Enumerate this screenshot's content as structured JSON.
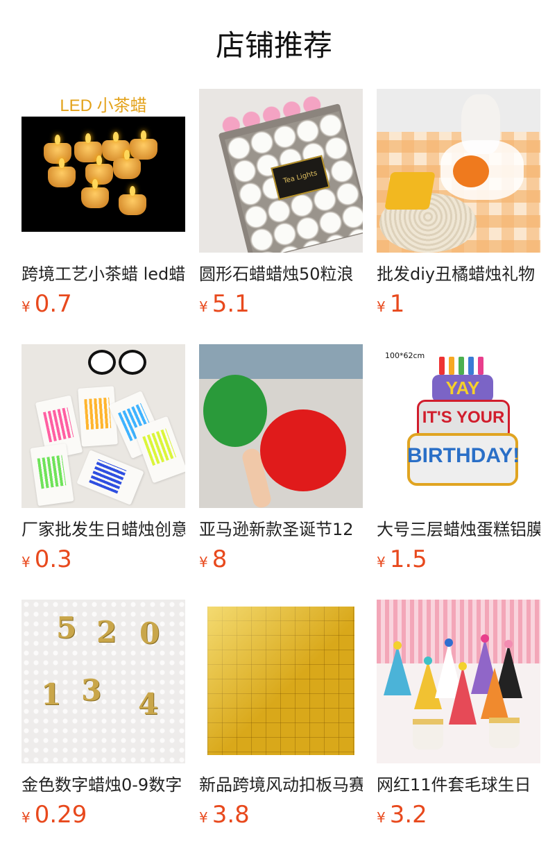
{
  "header": {
    "title": "店铺推荐"
  },
  "currency": "¥",
  "products": [
    {
      "name": "跨境工艺小茶蜡 led蜡",
      "price": "0.7",
      "image_text": "LED 小茶蜡"
    },
    {
      "name": "圆形石蜡蜡烛50粒浪",
      "price": "5.1",
      "image_text": "Tea Lights"
    },
    {
      "name": "批发diy丑橘蜡烛礼物",
      "price": "1"
    },
    {
      "name": "厂家批发生日蜡烛创意",
      "price": "0.3"
    },
    {
      "name": "亚马逊新款圣诞节12",
      "price": "8"
    },
    {
      "name": "大号三层蜡烛蛋糕铝膜",
      "price": "1.5",
      "image_text": "100*62cm",
      "balloon_text": [
        "YAY",
        "IT'S YOUR",
        "BIRTHDAY!"
      ]
    },
    {
      "name": "金色数字蜡烛0-9数字",
      "price": "0.29",
      "image_digits": [
        "5",
        "2",
        "0",
        "1",
        "3",
        "4"
      ]
    },
    {
      "name": "新品跨境风动扣板马赛",
      "price": "3.8"
    },
    {
      "name": "网红11件套毛球生日",
      "price": "3.2"
    }
  ]
}
